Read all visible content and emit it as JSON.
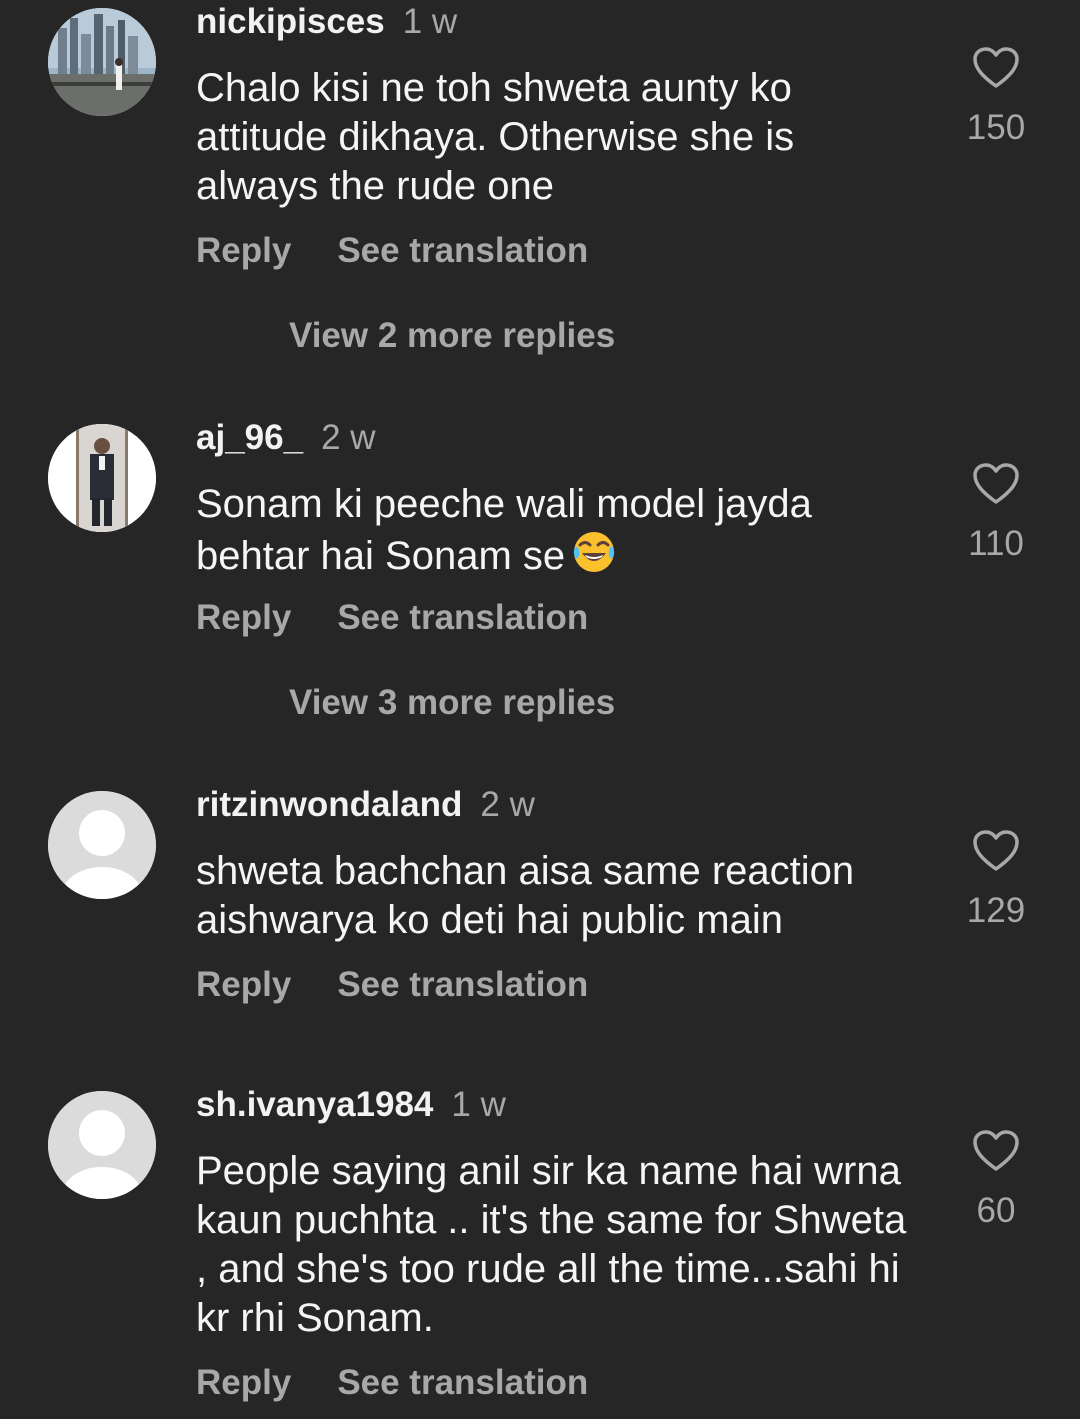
{
  "comments": [
    {
      "username": "nickipisces",
      "time": "1 w",
      "text": "Chalo kisi ne toh shweta aunty ko attitude dikhaya. Otherwise she is always the rude one",
      "likes": "150",
      "reply_label": "Reply",
      "translate_label": "See translation",
      "view_replies": "View 2 more replies",
      "avatar": "city-photo-avatar"
    },
    {
      "username": "aj_96_",
      "time": "2 w",
      "text": "Sonam ki peeche wali model jayda behtar hai Sonam se",
      "emoji": "face-with-tears-of-joy",
      "likes": "110",
      "reply_label": "Reply",
      "translate_label": "See translation",
      "view_replies": "View 3 more replies",
      "avatar": "person-in-suit-avatar"
    },
    {
      "username": "ritzinwondaland",
      "time": "2 w",
      "text": "shweta bachchan aisa same reaction aishwarya ko deti hai public main",
      "likes": "129",
      "reply_label": "Reply",
      "translate_label": "See translation",
      "avatar": "default-avatar"
    },
    {
      "username": "sh.ivanya1984",
      "time": "1 w",
      "text": "People saying anil sir ka name hai wrna kaun puchhta .. it's the same for Shweta , and she's too rude all the time...sahi hi kr rhi Sonam.",
      "likes": "60",
      "reply_label": "Reply",
      "translate_label": "See translation",
      "avatar": "default-avatar"
    }
  ],
  "colors": {
    "background": "#262626",
    "primary_text": "#f5f5f5",
    "secondary_text": "#a8a8a8"
  }
}
